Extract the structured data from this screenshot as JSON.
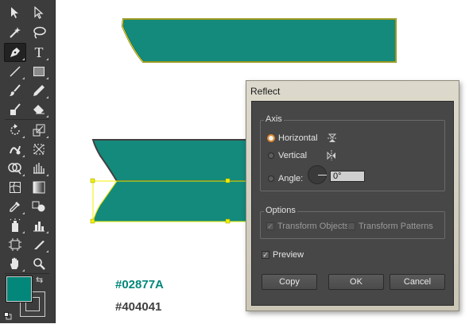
{
  "toolbar": {
    "tools": [
      {
        "name": "selection-tool",
        "icon": "selection-arrow-icon"
      },
      {
        "name": "direct-selection-tool",
        "icon": "direct-selection-arrow-icon"
      },
      {
        "name": "magic-wand-tool",
        "icon": "magic-wand-icon"
      },
      {
        "name": "lasso-tool",
        "icon": "lasso-icon"
      },
      {
        "name": "pen-tool",
        "icon": "pen-icon",
        "active": true
      },
      {
        "name": "type-tool",
        "icon": "type-icon",
        "glyph": "T"
      },
      {
        "name": "line-tool",
        "icon": "line-segment-icon"
      },
      {
        "name": "rectangle-tool",
        "icon": "rectangle-icon"
      },
      {
        "name": "paintbrush-tool",
        "icon": "paintbrush-icon"
      },
      {
        "name": "pencil-tool",
        "icon": "pencil-icon"
      },
      {
        "name": "blob-brush-tool",
        "icon": "blob-brush-icon"
      },
      {
        "name": "eraser-tool",
        "icon": "eraser-icon"
      },
      {
        "name": "rotate-tool",
        "icon": "rotate-icon"
      },
      {
        "name": "scale-tool",
        "icon": "scale-icon"
      },
      {
        "name": "warp-tool",
        "icon": "warp-icon"
      },
      {
        "name": "free-transform-tool",
        "icon": "free-transform-icon"
      },
      {
        "name": "shape-builder-tool",
        "icon": "shape-builder-icon"
      },
      {
        "name": "perspective-grid-tool",
        "icon": "perspective-grid-icon"
      },
      {
        "name": "mesh-tool",
        "icon": "mesh-icon"
      },
      {
        "name": "gradient-tool",
        "icon": "gradient-icon"
      },
      {
        "name": "eyedropper-tool",
        "icon": "eyedropper-icon"
      },
      {
        "name": "blend-tool",
        "icon": "blend-icon"
      },
      {
        "name": "symbol-sprayer-tool",
        "icon": "symbol-sprayer-icon"
      },
      {
        "name": "column-graph-tool",
        "icon": "column-graph-icon"
      },
      {
        "name": "artboard-tool",
        "icon": "artboard-icon"
      },
      {
        "name": "slice-tool",
        "icon": "slice-icon"
      },
      {
        "name": "hand-tool",
        "icon": "hand-icon"
      },
      {
        "name": "zoom-tool",
        "icon": "zoom-icon"
      }
    ],
    "fill_color": "#02877A",
    "stroke_color": "#404041"
  },
  "canvas": {
    "arrow_glyph": "↓",
    "shape_fill": "#138A7C",
    "shape_stroke": "#404041",
    "selection_color": "#f0f000",
    "fill_hex_label": "#02877A",
    "stroke_hex_label": "#404041"
  },
  "dialog": {
    "title": "Reflect",
    "axis_group_label": "Axis",
    "horizontal_label": "Horizontal",
    "vertical_label": "Vertical",
    "angle_label": "Angle:",
    "angle_value": "0°",
    "selected_axis": "horizontal",
    "options_group_label": "Options",
    "transform_objects_label": "Transform Objects",
    "transform_objects_checked": true,
    "transform_objects_disabled": true,
    "transform_patterns_label": "Transform Patterns",
    "transform_patterns_checked": false,
    "transform_patterns_disabled": true,
    "preview_label": "Preview",
    "preview_checked": true,
    "copy_label": "Copy",
    "ok_label": "OK",
    "cancel_label": "Cancel"
  }
}
